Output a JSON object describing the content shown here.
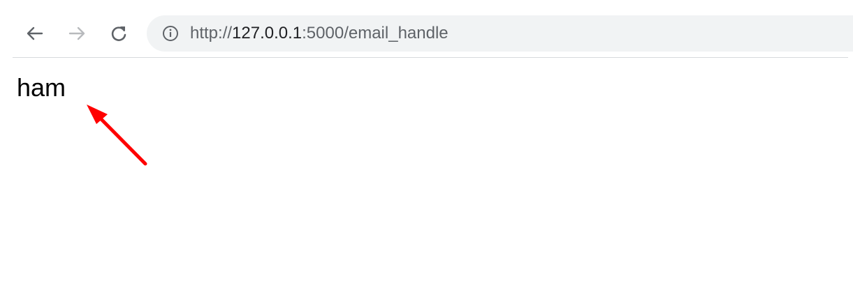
{
  "browser": {
    "url": {
      "scheme": "http://",
      "host": "127.0.0.1",
      "port_path": ":5000/email_handle"
    }
  },
  "page": {
    "body_text": "ham"
  },
  "colors": {
    "annotation_arrow": "#ff0000",
    "omnibox_bg": "#f1f3f4"
  },
  "icons": {
    "back": "back-arrow-icon",
    "forward": "forward-arrow-icon",
    "reload": "reload-icon",
    "site_info": "info-icon",
    "annotation": "red-arrow-annotation"
  }
}
